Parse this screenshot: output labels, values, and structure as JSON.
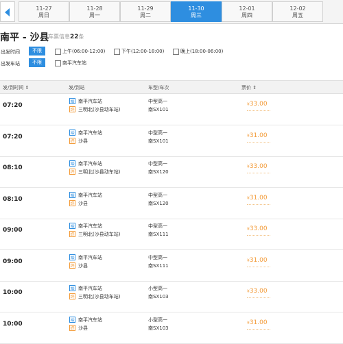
{
  "date_bar": {
    "dates": [
      {
        "date": "11-27",
        "weekday": "周日"
      },
      {
        "date": "11-28",
        "weekday": "周一"
      },
      {
        "date": "11-29",
        "weekday": "周二"
      },
      {
        "date": "11-30",
        "weekday": "周三"
      },
      {
        "date": "12-01",
        "weekday": "周四"
      },
      {
        "date": "12-02",
        "weekday": "周五"
      }
    ],
    "selected": "11-30",
    "accent_color": "#2e8ee0"
  },
  "title": {
    "route": "南平 - 沙县",
    "summary_prefix": "车票信息",
    "count": "22",
    "summary_suffix": "条"
  },
  "filters": {
    "time": {
      "label": "出发时间",
      "all": "不限",
      "options": [
        "上午(06:00-12:00)",
        "下午(12:00-18:00)",
        "晚上(18:00-06:00)"
      ]
    },
    "station": {
      "label": "出发车站",
      "all": "不限",
      "options": [
        "南平汽车站"
      ]
    }
  },
  "table": {
    "headers": {
      "time": "发/到时间 ⇕",
      "stations": "发/到站",
      "vehicle": "车型/车次",
      "price": "票价 ⇕"
    },
    "dep_tag": "始",
    "arr_tag": "终",
    "currency": "¥",
    "price_color": "#f39c3a",
    "rows": [
      {
        "time": "07:20",
        "from": "南平汽车站",
        "to": "三明北(沙县动车站)",
        "vehicle": "中型高一",
        "number": "南SX101",
        "price": "33.00"
      },
      {
        "time": "07:20",
        "from": "南平汽车站",
        "to": "沙县",
        "vehicle": "中型高一",
        "number": "南SX101",
        "price": "31.00"
      },
      {
        "time": "08:10",
        "from": "南平汽车站",
        "to": "三明北(沙县动车站)",
        "vehicle": "中型高一",
        "number": "南SX120",
        "price": "33.00"
      },
      {
        "time": "08:10",
        "from": "南平汽车站",
        "to": "沙县",
        "vehicle": "中型高一",
        "number": "南SX120",
        "price": "31.00"
      },
      {
        "time": "09:00",
        "from": "南平汽车站",
        "to": "三明北(沙县动车站)",
        "vehicle": "中型高一",
        "number": "南SX111",
        "price": "33.00"
      },
      {
        "time": "09:00",
        "from": "南平汽车站",
        "to": "沙县",
        "vehicle": "中型高一",
        "number": "南SX111",
        "price": "31.00"
      },
      {
        "time": "10:00",
        "from": "南平汽车站",
        "to": "三明北(沙县动车站)",
        "vehicle": "小型高一",
        "number": "南SX103",
        "price": "33.00"
      },
      {
        "time": "10:00",
        "from": "南平汽车站",
        "to": "沙县",
        "vehicle": "小型高一",
        "number": "南SX103",
        "price": "31.00"
      }
    ]
  }
}
